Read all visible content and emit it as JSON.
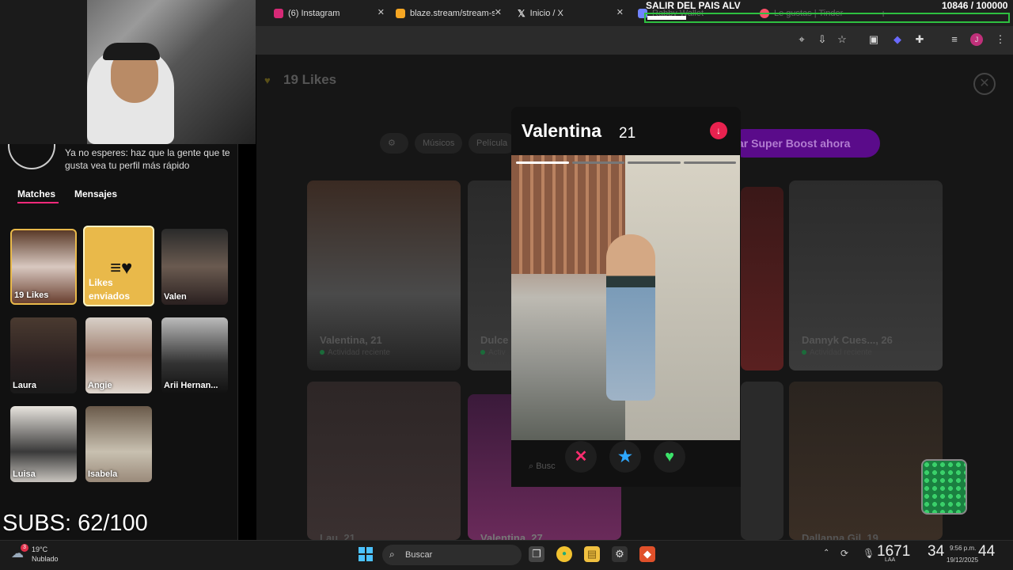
{
  "browser": {
    "tabs": [
      {
        "label": "(6) Instagram",
        "color": "#d62976"
      },
      {
        "label": "blaze.stream/stream-s",
        "color": "#f5a623"
      },
      {
        "label": "Inicio / X",
        "color": "#ffffff"
      },
      {
        "label": "Rabby Wallet",
        "color": "#7084ff"
      },
      {
        "label": "Le gustas | Tinder",
        "color": "#fd5068"
      }
    ]
  },
  "stream": {
    "title": "SALIR DEL PAIS ALV",
    "goal_counter": "10846  / 100000",
    "goal_progress": 0.108,
    "subs": "SUBS: 62/100"
  },
  "sidebar": {
    "boost_text": "Ya no esperes: haz que la gente que te gusta vea tu perfil más rápido",
    "tabs": {
      "matches": "Matches",
      "messages": "Mensajes"
    },
    "likes_card_label": "19 Likes",
    "likes_sent": {
      "line1": "Likes",
      "line2": "enviados"
    },
    "matches": [
      "Valen",
      "Laura",
      "Angie",
      "Arii Hernan...",
      "Luisa",
      "Isabela"
    ]
  },
  "main": {
    "likes_title": "19 Likes",
    "chips": [
      "Músicos",
      "Película"
    ],
    "super_boost": "ar Super Boost ahora",
    "cards": [
      {
        "name": "Valentina, 21",
        "activity": "Actividad reciente"
      },
      {
        "name": "Dulce",
        "activity": "Activ"
      },
      {
        "name": "Dannyk Cues..., 26",
        "activity": "Actividad reciente"
      },
      {
        "name": "Lau, 21"
      },
      {
        "name": "Valentina, 27"
      },
      {
        "name": "Dallanna Gil, 19"
      }
    ]
  },
  "profile": {
    "name": "Valentina",
    "age": "21",
    "photo_count": 4,
    "current_photo": 1,
    "search_hint": "Busc"
  },
  "taskbar": {
    "temperature": "19°C",
    "weather": "Nublado",
    "weather_badge": "3",
    "search_label": "Buscar",
    "lang": "LAA",
    "clock_big1": "1671",
    "clock_big2": "34",
    "clock_big3": "44",
    "time": "9:56 p.m.",
    "date": "19/12/2025"
  }
}
